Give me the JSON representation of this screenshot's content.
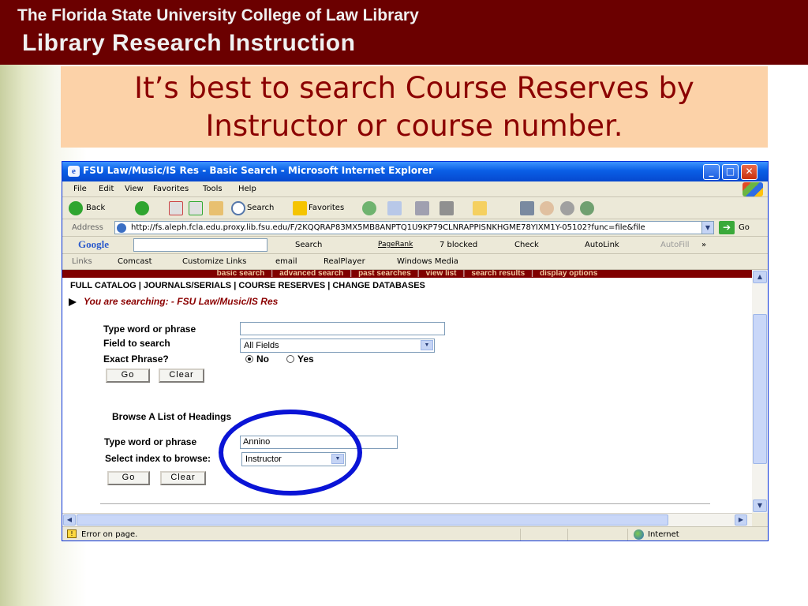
{
  "slide": {
    "header_line1": "The Florida State University College of Law Library",
    "header_line2": "Library Research Instruction",
    "title": "It’s best to search Course Reserves by Instructor or course number."
  },
  "window": {
    "title": "FSU Law/Music/IS Res - Basic Search - Microsoft Internet Explorer",
    "controls": {
      "minimize": "_",
      "maximize": "□",
      "close": "✕"
    }
  },
  "menubar": [
    "File",
    "Edit",
    "View",
    "Favorites",
    "Tools",
    "Help"
  ],
  "toolbar": {
    "back": "Back",
    "search": "Search",
    "favorites": "Favorites"
  },
  "addressbar": {
    "label": "Address",
    "url": "http://fs.aleph.fcla.edu.proxy.lib.fsu.edu/F/2KQQRAP83MX5MB8ANPTQ1U9KP79CLNRAPPISNKHGME78YIXM1Y-05102?func=file&file",
    "go": "Go"
  },
  "googlebar": {
    "logo": "Google",
    "search": "Search",
    "pagerank": "PageRank",
    "blocked": "7 blocked",
    "check": "Check",
    "autolink": "AutoLink",
    "autofill": "AutoFill",
    "more": "»"
  },
  "linksbar": [
    "Links",
    "Comcast",
    "Customize Links",
    "email",
    "RealPlayer",
    "Windows Media"
  ],
  "page": {
    "nav_top": [
      "basic search",
      "advanced search",
      "past searches",
      "view list",
      "search results",
      "display options"
    ],
    "catalog_links": "FULL CATALOG | JOURNALS/SERIALS | COURSE RESERVES | CHANGE DATABASES",
    "searching": "You are searching: - FSU Law/Music/IS Res",
    "form1": {
      "word_label": "Type word or phrase",
      "word_value": "",
      "field_label": "Field to search",
      "field_value": "All Fields",
      "exact_label": "Exact Phrase?",
      "no": "No",
      "yes": "Yes",
      "go": "Go",
      "clear": "Clear"
    },
    "browse_heading": "Browse A List of Headings",
    "form2": {
      "word_label": "Type word or phrase",
      "word_value": "Annino",
      "index_label": "Select index to browse:",
      "index_value": "Instructor",
      "go": "Go",
      "clear": "Clear"
    }
  },
  "status": {
    "message": "Error on page.",
    "zone": "Internet"
  },
  "colors": {
    "header": "#6b0000",
    "title_box": "#fcd2a8",
    "title_text": "#8b0000",
    "annotation_circle": "#0a14d6"
  }
}
